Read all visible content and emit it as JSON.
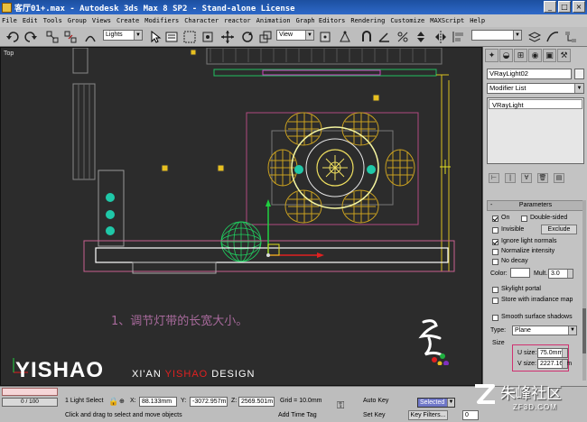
{
  "window": {
    "title": "客厅01+.max - Autodesk 3ds Max 8 SP2  - Stand-alone License"
  },
  "menu": [
    "File",
    "Edit",
    "Tools",
    "Group",
    "Views",
    "Create",
    "Modifiers",
    "Character",
    "reactor",
    "Animation",
    "Graph Editors",
    "Rendering",
    "Customize",
    "MAXScript",
    "Help"
  ],
  "toolbar": {
    "selection_filter": "Lights",
    "reference_coord": "View"
  },
  "viewport": {
    "label": "Top",
    "annotation": "1、调节灯带的长宽大小。",
    "logo_main": "YISHAO",
    "logo_sub_1": "XI'AN ",
    "logo_sub_2": "YISHAO",
    "logo_sub_3": " DESIGN"
  },
  "command_panel": {
    "object_name": "VRayLight02",
    "modifier_list": "Modifier List",
    "stack_item": "VRayLight",
    "rollout_title": "Parameters",
    "on_label": "On",
    "double_sided_label": "Double-sided",
    "invisible_label": "Invisible",
    "exclude_button": "Exclude",
    "ignore_normals_label": "Ignore light normals",
    "normalize_label": "Normalize intensity",
    "no_decay_label": "No decay",
    "color_label": "Color:",
    "mult_label": "Mult.",
    "mult_value": "3.0",
    "skylight_label": "Skylight portal",
    "irradiance_label": "Store with irradiance map",
    "smooth_shadows_label": "Smooth surface shadows",
    "type_label": "Type:",
    "type_value": "Plane",
    "size_label": "Size",
    "u_size_label": "U size:",
    "u_size_value": "75.0mm",
    "v_size_label": "V size:",
    "v_size_value": "2227.161m"
  },
  "status": {
    "time_position": "0 / 100",
    "selection": "1 Light Select",
    "x_label": "X:",
    "x_value": "88.133mm",
    "y_label": "Y:",
    "y_value": "-3072.957m",
    "z_label": "Z:",
    "z_value": "2569.501m",
    "grid": "Grid = 10.0mm",
    "prompt": "Click and drag to select and move objects",
    "add_time_tag": "Add Time Tag",
    "auto_key": "Auto Key",
    "auto_key_mode": "Selected",
    "set_key": "Set Key",
    "key_filters": "Key Filters...",
    "frame_value": "0"
  },
  "watermark": {
    "text_cn": "朱峰社区",
    "text_en": "ZF3D.COM"
  },
  "colors": {
    "viewport_bg": "#2c2c2c",
    "chair": "#c9a020",
    "table": "#f5f5a0",
    "selected_light": "#ffffff",
    "accent_pink": "#d03070"
  }
}
